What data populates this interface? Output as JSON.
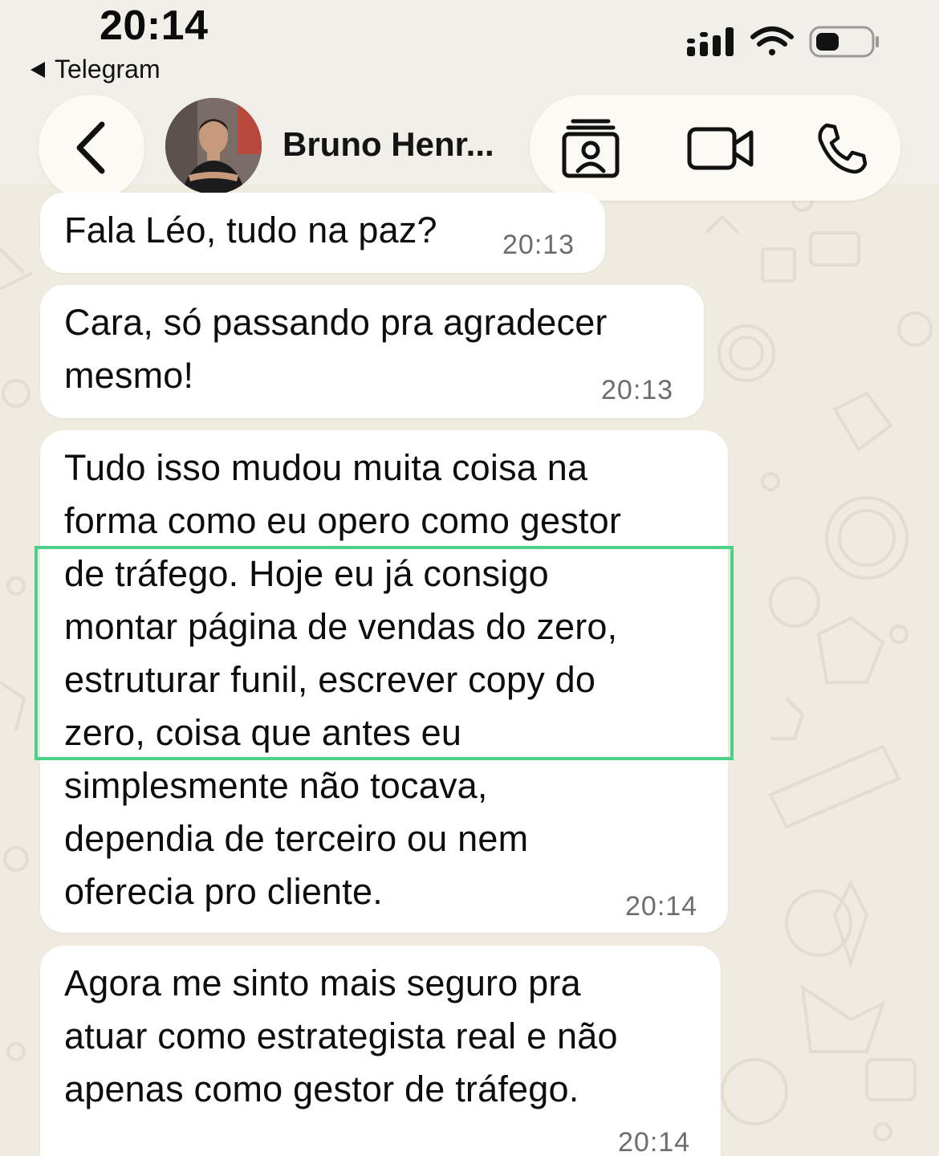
{
  "status_bar": {
    "time": "20:14",
    "back_app_label": "Telegram",
    "icons": [
      "cellular-signal-icon",
      "wifi-icon",
      "battery-icon"
    ]
  },
  "header": {
    "back_icon": "chevron-left-icon",
    "contact_name": "Bruno Henr...",
    "actions": [
      "profile-card-icon",
      "video-camera-icon",
      "phone-icon"
    ]
  },
  "messages": [
    {
      "lines": [
        "Fala Léo, tudo na paz?"
      ],
      "time": "20:13"
    },
    {
      "lines": [
        "Cara, só passando pra agradecer",
        "mesmo!"
      ],
      "time": "20:13"
    },
    {
      "lines": [
        "Tudo isso mudou muita coisa na",
        "forma como eu opero como gestor",
        "de tráfego. Hoje eu já consigo",
        "montar página de vendas do zero,",
        "estruturar funil, escrever copy do",
        "zero, coisa que antes eu",
        "simplesmente não tocava,",
        "dependia de terceiro ou nem",
        "oferecia pro cliente."
      ],
      "time": "20:14"
    },
    {
      "lines": [
        "Agora me sinto mais seguro pra",
        "atuar como estrategista real e não",
        "apenas como gestor de tráfego."
      ],
      "time": "20:14"
    }
  ],
  "colors": {
    "highlight": "#4cd186",
    "wallpaper": "#efebe1",
    "bubble": "#ffffff"
  }
}
